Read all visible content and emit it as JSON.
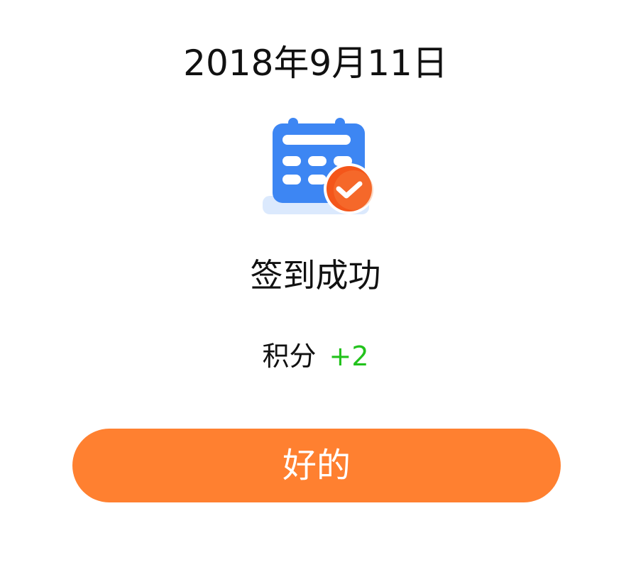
{
  "dialog": {
    "date": "2018年9月11日",
    "icon": "calendar-check-icon",
    "title": "签到成功",
    "points_label": "积分",
    "points_delta": "+2",
    "confirm_label": "好的"
  },
  "colors": {
    "calendar_blue": "#3d86f3",
    "badge_orange": "#f4561a",
    "points_green": "#22c21c",
    "button_orange": "#ff8030"
  }
}
